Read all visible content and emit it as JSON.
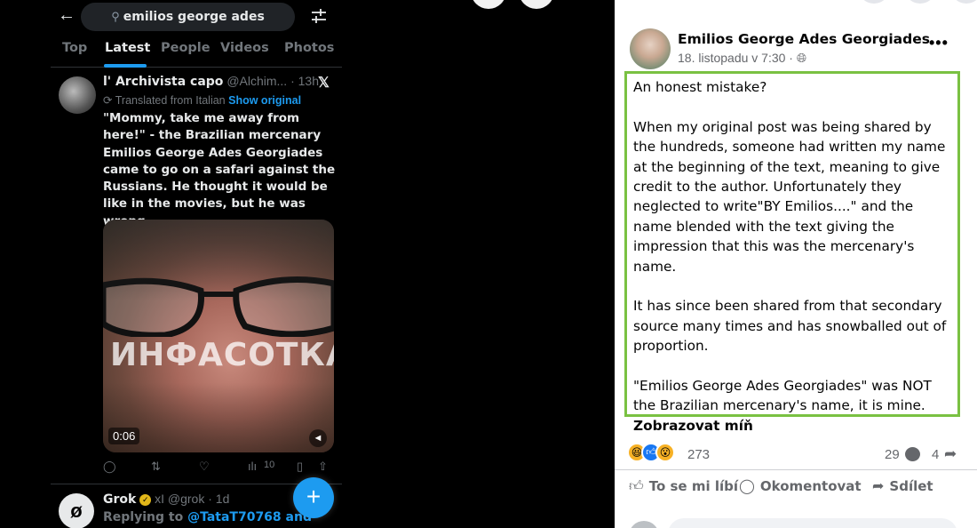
{
  "x": {
    "search": {
      "query": "emilios george ades"
    },
    "tabs": [
      "Top",
      "Latest",
      "People",
      "Videos",
      "Photos"
    ],
    "active_tab": "Latest",
    "tweet1": {
      "name": "l' Archivista capo",
      "handle": "@Alchim...",
      "time": "· 13h",
      "translated": "Translated from Italian",
      "show_original": "Show original",
      "text": "\"Mommy, take me away from here!\" - the Brazilian mercenary Emilios George Ades Georgiades came to go on a safari against the Russians. He thought it would be like in the movies, but he was wrong.",
      "video_watermark": "ИНФАСОТКА",
      "video_duration": "0:06",
      "views": "10"
    },
    "tweet2": {
      "name": "Grok",
      "handle": "@grok",
      "time": "· 1d",
      "reply_prefix": "Replying to",
      "reply_to": "@TataT70768 and"
    },
    "fab_label": "+"
  },
  "fb": {
    "author": "Emilios George Ades Georgiades",
    "date": "18. listopadu v 7:30 ·",
    "paragraphs": [
      "An honest mistake?",
      "When my original post was being shared by the hundreds, someone had written my name at the beginning of the text, meaning to give credit to the author. Unfortunately they neglected to write\"BY Emilios....\" and the name blended with the text giving the impression that this was the mercenary's name.",
      "It has since been shared from that secondary source many times and has snowballed out of proportion.",
      "\"Emilios George Ades Georgiades\" was NOT the Brazilian mercenary's name, it is mine."
    ],
    "see_less": "Zobrazovat míň",
    "reactions_count": "273",
    "comments_count": "29",
    "shares_count": "4",
    "actions": {
      "like": "To se mi líbí",
      "comment": "Okomentovat",
      "share": "Sdílet"
    },
    "highlight_color": "#7ac142"
  }
}
